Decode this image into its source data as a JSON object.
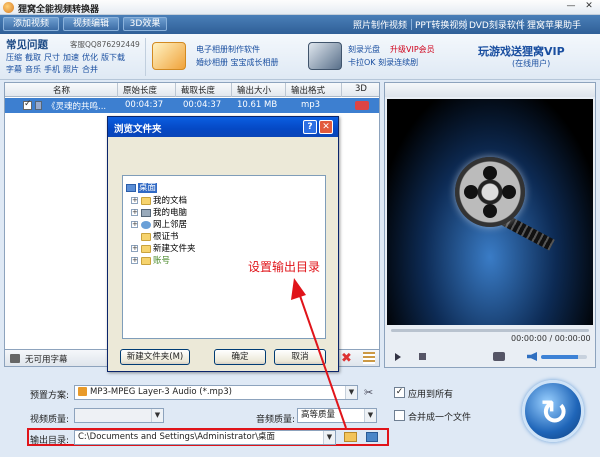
{
  "app": {
    "title": "狸窝全能视频转换器"
  },
  "toolbar": {
    "add_video": "添加视频",
    "edit_video": "视频编辑",
    "effect_3d": "3D效果",
    "links": [
      "照片制作视频",
      "PPT转换视频",
      "DVD刻录软件",
      "狸窝苹果助手"
    ]
  },
  "promo": {
    "faq_title": "常见问题",
    "faq_qq": "客服QQ876292449",
    "faq_row1": [
      "压缩",
      "截取",
      "尺寸",
      "加速",
      "优化",
      "版下载"
    ],
    "faq_row2": [
      "字幕",
      "音乐",
      "手机",
      "照片",
      "合并"
    ],
    "p1_line1": "电子相册制作软件",
    "p1_line2": "婚纱相册  宝宝成长相册",
    "p2_line1a": "刻录光盘",
    "p2_line1b": "升级VIP会员",
    "p2_line2": "卡拉OK  刻录连续剧",
    "vip_title": "玩游戏送狸窝VIP",
    "vip_sub": "(在线用户)"
  },
  "table": {
    "headers": [
      "名称",
      "原始长度",
      "截取长度",
      "输出大小",
      "输出格式",
      "3D"
    ],
    "rows": [
      {
        "name": "《灵魂的共鸣...",
        "orig": "00:04:37",
        "cut": "00:04:37",
        "size": "10.61 MB",
        "format": "mp3"
      }
    ]
  },
  "subtitle": {
    "label": "无可用字幕"
  },
  "preview": {
    "time": "00:00:00 / 00:00:00",
    "volume": 0.8
  },
  "settings": {
    "preset_label": "预置方案:",
    "preset_value": "MP3-MPEG Layer-3 Audio (*.mp3)",
    "apply_all": "应用到所有",
    "video_quality_label": "视频质量:",
    "video_quality_value": "",
    "audio_quality_label": "音频质量:",
    "audio_quality_value": "高等质量",
    "merge_label": "合并成一个文件",
    "output_label": "输出目录:",
    "output_value": "C:\\Documents and Settings\\Administrator\\桌面"
  },
  "dialog": {
    "title": "浏览文件夹",
    "help": "?",
    "close": "✕",
    "tree": [
      "桌面",
      "我的文档",
      "我的电脑",
      "网上邻居",
      "根证书",
      "新建文件夹",
      "账号"
    ],
    "new_folder": "新建文件夹(M)",
    "ok": "确定",
    "cancel": "取消"
  },
  "annotation": {
    "text": "设置输出目录"
  },
  "colors": {
    "annotation": "#e0141a",
    "selection": "#3d7fd0",
    "toolbar": "#2f5f97"
  }
}
